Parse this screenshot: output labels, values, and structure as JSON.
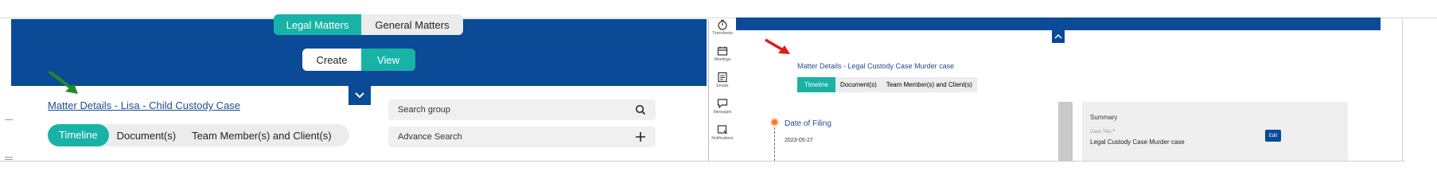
{
  "left": {
    "matter_type_tabs": [
      "Legal Matters",
      "General Matters"
    ],
    "mode_tabs": [
      "Create",
      "View"
    ],
    "matter_title": "Matter Details - Lisa - Child Custody Case",
    "tabs": [
      "Timeline",
      "Document(s)",
      "Team Member(s) and Client(s)"
    ],
    "search_placeholder": "Search group",
    "advance_search": "Advance Search"
  },
  "right": {
    "side_icons": [
      {
        "icon": "stopwatch-icon",
        "label": "Timesheets"
      },
      {
        "icon": "calendar-icon",
        "label": "Meetings"
      },
      {
        "icon": "email-icon",
        "label": "Emails"
      },
      {
        "icon": "chat-icon",
        "label": "Messages"
      },
      {
        "icon": "notification-icon",
        "label": "Notifications"
      }
    ],
    "matter_title": "Matter Details - Legal Custody Case Murder case",
    "tabs": [
      "Timeline",
      "Document(s)",
      "Team Member(s) and Client(s)"
    ],
    "timeline_event": "Date of Filing",
    "timeline_date": "2023-05-27",
    "summary_title": "Summary",
    "case_title_label": "Case Title",
    "case_title_value": "Legal Custody Case Murder case",
    "edit_label": "Edit"
  },
  "colors": {
    "brand_blue": "#0b4a97",
    "accent_teal": "#18b3a6",
    "timeline_orange": "#f07a2e",
    "arrow_green": "#1f8a2a",
    "arrow_red": "#e21b1b"
  }
}
